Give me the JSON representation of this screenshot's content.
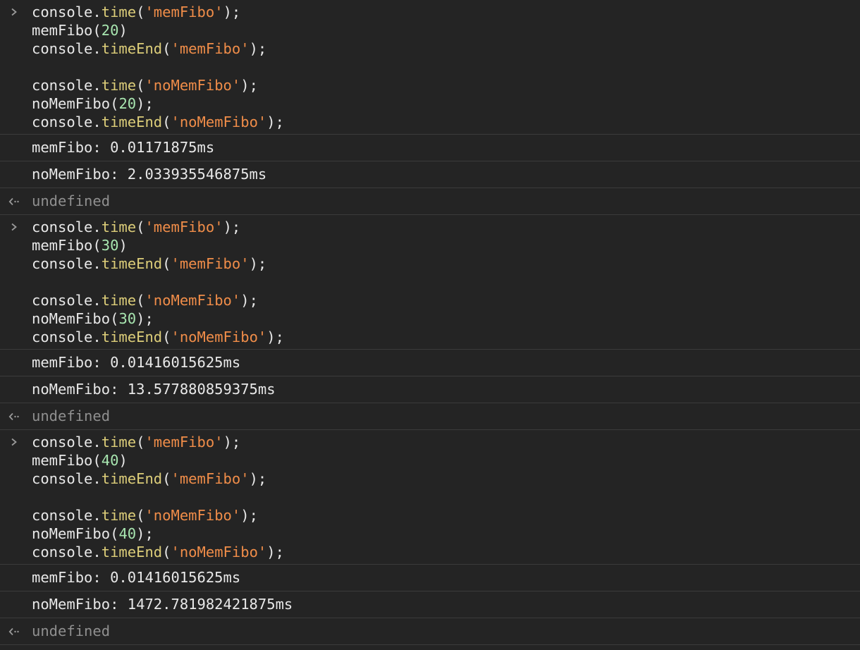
{
  "colors": {
    "background": "#242424",
    "divider": "#3b3b3b",
    "default_text": "#e8e8e8",
    "function": "#dccd79",
    "string": "#f08d49",
    "number": "#a8e6b0",
    "undefined": "#8f8f8f"
  },
  "icons": {
    "prompt": "chevron-right-icon",
    "result": "return-arrow-icon"
  },
  "entries": [
    {
      "type": "input",
      "lines": [
        [
          {
            "t": "obj",
            "v": "console"
          },
          {
            "t": "punct",
            "v": "."
          },
          {
            "t": "fn",
            "v": "time"
          },
          {
            "t": "punct",
            "v": "("
          },
          {
            "t": "str",
            "v": "'memFibo'"
          },
          {
            "t": "punct",
            "v": ");"
          }
        ],
        [
          {
            "t": "obj",
            "v": "memFibo"
          },
          {
            "t": "punct",
            "v": "("
          },
          {
            "t": "num",
            "v": "20"
          },
          {
            "t": "punct",
            "v": ")"
          }
        ],
        [
          {
            "t": "obj",
            "v": "console"
          },
          {
            "t": "punct",
            "v": "."
          },
          {
            "t": "fn",
            "v": "timeEnd"
          },
          {
            "t": "punct",
            "v": "("
          },
          {
            "t": "str",
            "v": "'memFibo'"
          },
          {
            "t": "punct",
            "v": ");"
          }
        ],
        [],
        [
          {
            "t": "obj",
            "v": "console"
          },
          {
            "t": "punct",
            "v": "."
          },
          {
            "t": "fn",
            "v": "time"
          },
          {
            "t": "punct",
            "v": "("
          },
          {
            "t": "str",
            "v": "'noMemFibo'"
          },
          {
            "t": "punct",
            "v": ");"
          }
        ],
        [
          {
            "t": "obj",
            "v": "noMemFibo"
          },
          {
            "t": "punct",
            "v": "("
          },
          {
            "t": "num",
            "v": "20"
          },
          {
            "t": "punct",
            "v": ");"
          }
        ],
        [
          {
            "t": "obj",
            "v": "console"
          },
          {
            "t": "punct",
            "v": "."
          },
          {
            "t": "fn",
            "v": "timeEnd"
          },
          {
            "t": "punct",
            "v": "("
          },
          {
            "t": "str",
            "v": "'noMemFibo'"
          },
          {
            "t": "punct",
            "v": ");"
          }
        ]
      ]
    },
    {
      "type": "log",
      "text": "memFibo: 0.01171875ms"
    },
    {
      "type": "log",
      "text": "noMemFibo: 2.033935546875ms"
    },
    {
      "type": "result",
      "text": "undefined"
    },
    {
      "type": "input",
      "lines": [
        [
          {
            "t": "obj",
            "v": "console"
          },
          {
            "t": "punct",
            "v": "."
          },
          {
            "t": "fn",
            "v": "time"
          },
          {
            "t": "punct",
            "v": "("
          },
          {
            "t": "str",
            "v": "'memFibo'"
          },
          {
            "t": "punct",
            "v": ");"
          }
        ],
        [
          {
            "t": "obj",
            "v": "memFibo"
          },
          {
            "t": "punct",
            "v": "("
          },
          {
            "t": "num",
            "v": "30"
          },
          {
            "t": "punct",
            "v": ")"
          }
        ],
        [
          {
            "t": "obj",
            "v": "console"
          },
          {
            "t": "punct",
            "v": "."
          },
          {
            "t": "fn",
            "v": "timeEnd"
          },
          {
            "t": "punct",
            "v": "("
          },
          {
            "t": "str",
            "v": "'memFibo'"
          },
          {
            "t": "punct",
            "v": ");"
          }
        ],
        [],
        [
          {
            "t": "obj",
            "v": "console"
          },
          {
            "t": "punct",
            "v": "."
          },
          {
            "t": "fn",
            "v": "time"
          },
          {
            "t": "punct",
            "v": "("
          },
          {
            "t": "str",
            "v": "'noMemFibo'"
          },
          {
            "t": "punct",
            "v": ");"
          }
        ],
        [
          {
            "t": "obj",
            "v": "noMemFibo"
          },
          {
            "t": "punct",
            "v": "("
          },
          {
            "t": "num",
            "v": "30"
          },
          {
            "t": "punct",
            "v": ");"
          }
        ],
        [
          {
            "t": "obj",
            "v": "console"
          },
          {
            "t": "punct",
            "v": "."
          },
          {
            "t": "fn",
            "v": "timeEnd"
          },
          {
            "t": "punct",
            "v": "("
          },
          {
            "t": "str",
            "v": "'noMemFibo'"
          },
          {
            "t": "punct",
            "v": ");"
          }
        ]
      ]
    },
    {
      "type": "log",
      "text": "memFibo: 0.01416015625ms"
    },
    {
      "type": "log",
      "text": "noMemFibo: 13.577880859375ms"
    },
    {
      "type": "result",
      "text": "undefined"
    },
    {
      "type": "input",
      "lines": [
        [
          {
            "t": "obj",
            "v": "console"
          },
          {
            "t": "punct",
            "v": "."
          },
          {
            "t": "fn",
            "v": "time"
          },
          {
            "t": "punct",
            "v": "("
          },
          {
            "t": "str",
            "v": "'memFibo'"
          },
          {
            "t": "punct",
            "v": ");"
          }
        ],
        [
          {
            "t": "obj",
            "v": "memFibo"
          },
          {
            "t": "punct",
            "v": "("
          },
          {
            "t": "num",
            "v": "40"
          },
          {
            "t": "punct",
            "v": ")"
          }
        ],
        [
          {
            "t": "obj",
            "v": "console"
          },
          {
            "t": "punct",
            "v": "."
          },
          {
            "t": "fn",
            "v": "timeEnd"
          },
          {
            "t": "punct",
            "v": "("
          },
          {
            "t": "str",
            "v": "'memFibo'"
          },
          {
            "t": "punct",
            "v": ");"
          }
        ],
        [],
        [
          {
            "t": "obj",
            "v": "console"
          },
          {
            "t": "punct",
            "v": "."
          },
          {
            "t": "fn",
            "v": "time"
          },
          {
            "t": "punct",
            "v": "("
          },
          {
            "t": "str",
            "v": "'noMemFibo'"
          },
          {
            "t": "punct",
            "v": ");"
          }
        ],
        [
          {
            "t": "obj",
            "v": "noMemFibo"
          },
          {
            "t": "punct",
            "v": "("
          },
          {
            "t": "num",
            "v": "40"
          },
          {
            "t": "punct",
            "v": ");"
          }
        ],
        [
          {
            "t": "obj",
            "v": "console"
          },
          {
            "t": "punct",
            "v": "."
          },
          {
            "t": "fn",
            "v": "timeEnd"
          },
          {
            "t": "punct",
            "v": "("
          },
          {
            "t": "str",
            "v": "'noMemFibo'"
          },
          {
            "t": "punct",
            "v": ");"
          }
        ]
      ]
    },
    {
      "type": "log",
      "text": "memFibo: 0.01416015625ms"
    },
    {
      "type": "log",
      "text": "noMemFibo: 1472.781982421875ms"
    },
    {
      "type": "result",
      "text": "undefined"
    }
  ]
}
